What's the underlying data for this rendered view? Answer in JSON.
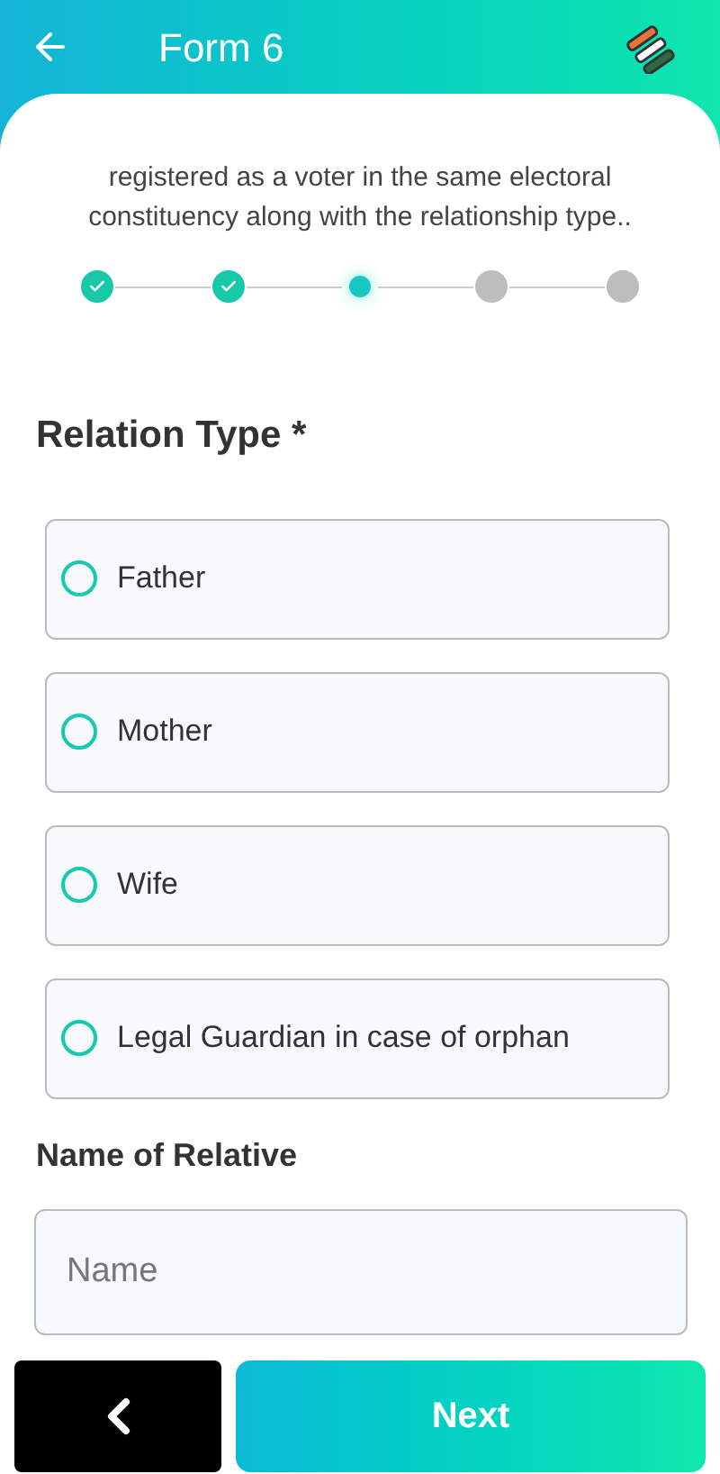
{
  "header": {
    "title": "Form 6"
  },
  "description": "registered as a voter in the same electoral constituency along with the relationship type..",
  "steps": [
    {
      "kind": "done"
    },
    {
      "kind": "done"
    },
    {
      "kind": "current"
    },
    {
      "kind": "pending"
    },
    {
      "kind": "pending"
    }
  ],
  "relation_type": {
    "label": "Relation Type *",
    "options": [
      {
        "label": "Father",
        "selected": false
      },
      {
        "label": "Mother",
        "selected": false
      },
      {
        "label": "Wife",
        "selected": false
      },
      {
        "label": "Legal Guardian in case of orphan",
        "selected": false
      }
    ]
  },
  "relative_name": {
    "label": "Name of Relative",
    "placeholder": "Name"
  },
  "footer": {
    "next": "Next"
  }
}
